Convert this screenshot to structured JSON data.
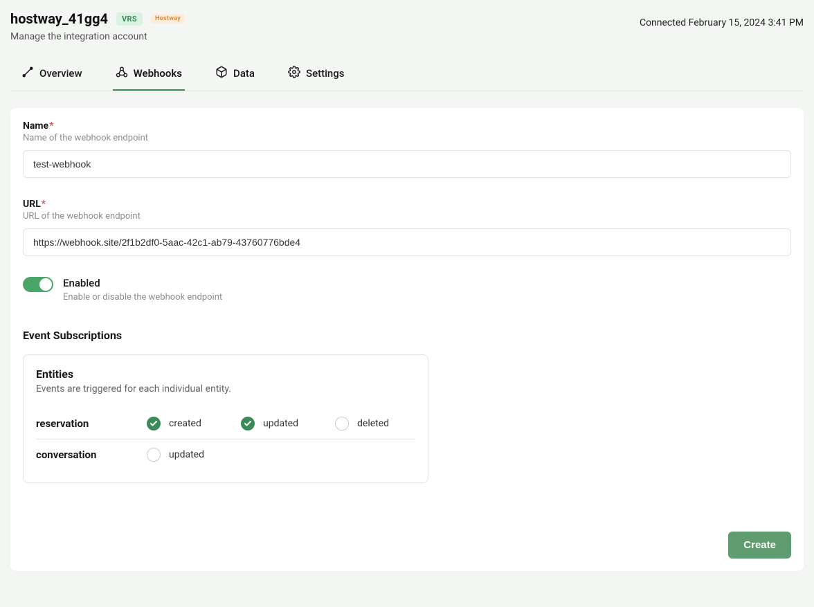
{
  "header": {
    "title": "hostway_41gg4",
    "badge_vrs": "VRS",
    "badge_hostway": "Hostway",
    "subtitle": "Manage the integration account",
    "connected": "Connected February 15, 2024 3:41 PM"
  },
  "tabs": {
    "overview": "Overview",
    "webhooks": "Webhooks",
    "data": "Data",
    "settings": "Settings"
  },
  "form": {
    "name": {
      "label": "Name",
      "desc": "Name of the webhook endpoint",
      "value": "test-webhook"
    },
    "url": {
      "label": "URL",
      "desc": "URL of the webhook endpoint",
      "value": "https://webhook.site/2f1b2df0-5aac-42c1-ab79-43760776bde4"
    },
    "enabled": {
      "label": "Enabled",
      "desc": "Enable or disable the webhook endpoint",
      "on": true
    }
  },
  "events": {
    "title": "Event Subscriptions",
    "entities": {
      "title": "Entities",
      "desc": "Events are triggered for each individual entity.",
      "rows": [
        {
          "name": "reservation",
          "options": [
            {
              "label": "created",
              "checked": true
            },
            {
              "label": "updated",
              "checked": true
            },
            {
              "label": "deleted",
              "checked": false
            }
          ]
        },
        {
          "name": "conversation",
          "options": [
            {
              "label": "updated",
              "checked": false
            }
          ]
        }
      ]
    }
  },
  "buttons": {
    "create": "Create"
  }
}
